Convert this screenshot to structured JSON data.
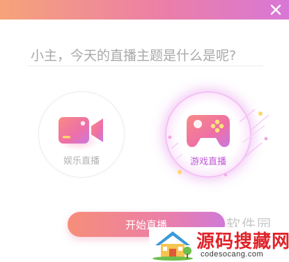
{
  "dialog": {
    "close_icon": "close-icon",
    "accent_gradient": [
      "#f6a37a",
      "#ec7fa6",
      "#d877d6"
    ]
  },
  "topic_input": {
    "placeholder": "小主，今天的直播主题是什么是呢?",
    "value": ""
  },
  "modes": [
    {
      "label": "娱乐直播",
      "icon": "video-camera-icon",
      "selected": false
    },
    {
      "label": "游戏直播",
      "icon": "gamepad-icon",
      "selected": true
    }
  ],
  "start_button": {
    "label": "开始直播"
  },
  "watermark": {
    "side_text": "软件园",
    "name": "源码搜藏网",
    "url": "codesocang.com",
    "icon": "house-logo-icon"
  }
}
